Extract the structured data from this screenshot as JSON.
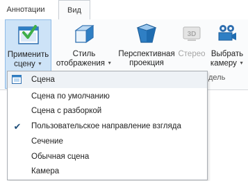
{
  "tabs": [
    {
      "label": "Аннотации"
    },
    {
      "label": "Вид"
    }
  ],
  "ribbon": {
    "buttons": [
      {
        "label_line1": "Применить",
        "label_line2": "сцену",
        "icon": "apply-scene-icon"
      },
      {
        "label_line1": "Стиль",
        "label_line2": "отображения",
        "icon": "display-style-icon"
      },
      {
        "label_line1": "Перспективная",
        "label_line2": "проекция",
        "icon": "perspective-projection-icon"
      },
      {
        "label_line1": "Стерео",
        "icon": "stereo-3d-icon"
      },
      {
        "label_line1": "Выбрать",
        "label_line2": "камеру",
        "icon": "camera-icon"
      }
    ],
    "group_label_partial": "дель"
  },
  "menu": {
    "header": "Сцена",
    "items": [
      {
        "label": "Сцена по умолчанию",
        "checked": false
      },
      {
        "label": "Сцена с разборкой",
        "checked": false
      },
      {
        "label": "Пользовательское направление взгляда",
        "checked": true
      },
      {
        "label": "Сечение",
        "checked": false
      },
      {
        "label": "Обычная сцена",
        "checked": false
      },
      {
        "label": "Камера",
        "checked": false
      }
    ]
  },
  "colors": {
    "selected_button_bg": "#cde3f7",
    "accent_green": "#3fae49",
    "icon_blue": "#2f7fc4"
  }
}
